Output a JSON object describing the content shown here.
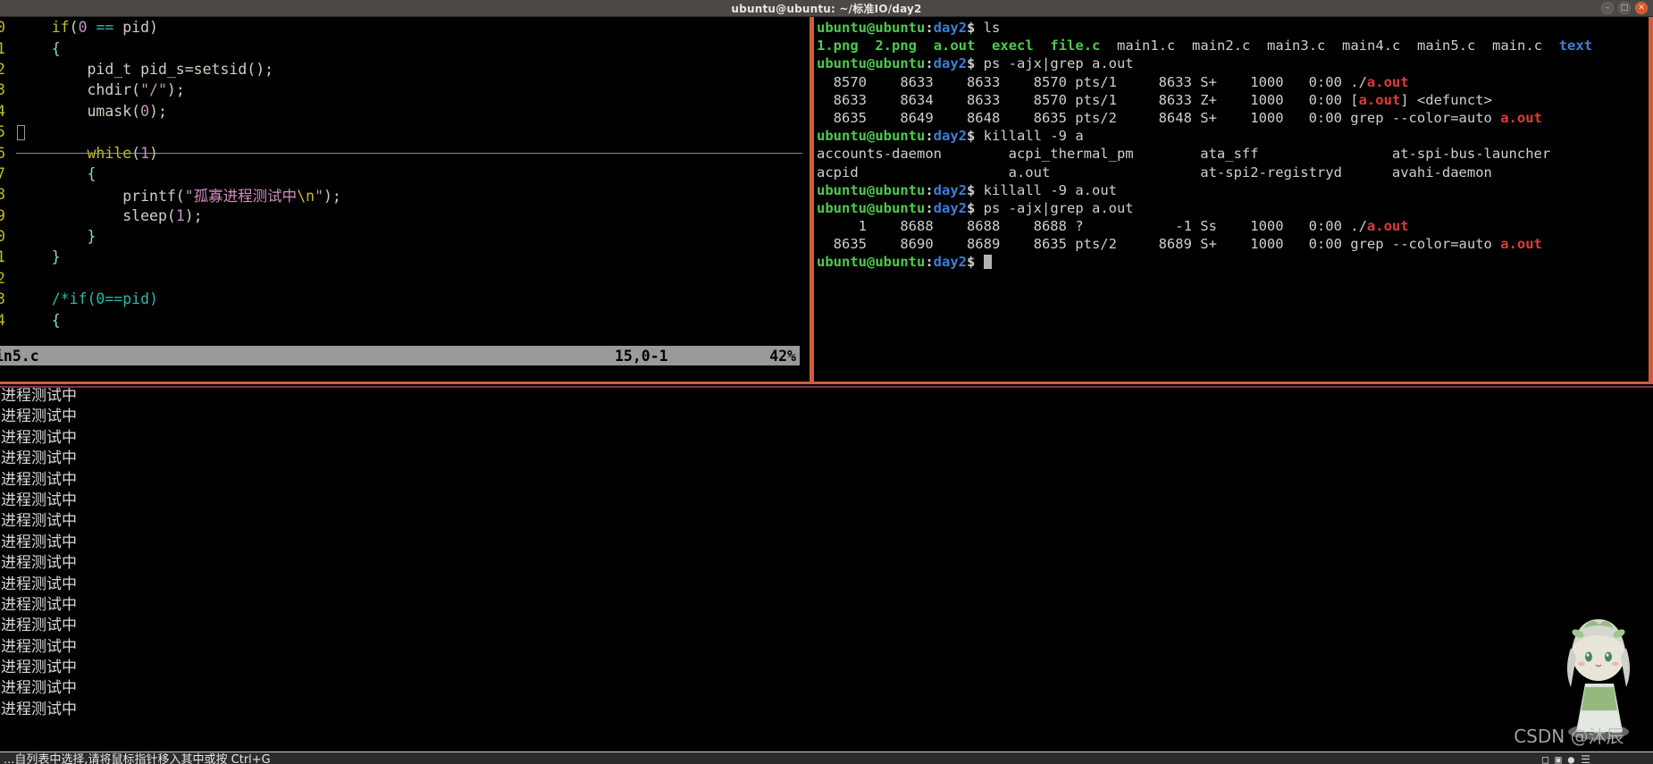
{
  "window": {
    "title": "ubuntu@ubuntu: ~/标准IO/day2",
    "controls": [
      {
        "name": "minimize",
        "glyph": "–"
      },
      {
        "name": "maximize",
        "glyph": "□"
      },
      {
        "name": "close",
        "glyph": "✕"
      }
    ]
  },
  "editor": {
    "filename": "in5.c",
    "position": "15,0-1",
    "percent": "42%",
    "lines": [
      {
        "num": "0",
        "indent": 4,
        "text": "if(0 == pid)"
      },
      {
        "num": "1",
        "indent": 4,
        "text": "{"
      },
      {
        "num": "2",
        "indent": 8,
        "text": "pid_t pid_s=setsid();"
      },
      {
        "num": "3",
        "indent": 8,
        "text": "chdir(\"/\");"
      },
      {
        "num": "4",
        "indent": 8,
        "text": "umask(0);"
      },
      {
        "num": "5",
        "indent": 0,
        "text": ""
      },
      {
        "num": "6",
        "indent": 8,
        "text": "while(1)"
      },
      {
        "num": "7",
        "indent": 8,
        "text": "{"
      },
      {
        "num": "8",
        "indent": 12,
        "text": "printf(\"孤寡进程测试中\\n\");"
      },
      {
        "num": "9",
        "indent": 12,
        "text": "sleep(1);"
      },
      {
        "num": "0",
        "indent": 8,
        "text": "}"
      },
      {
        "num": "1",
        "indent": 4,
        "text": "}"
      },
      {
        "num": "2",
        "indent": 0,
        "text": ""
      },
      {
        "num": "3",
        "indent": 4,
        "text": "/*if(0==pid)"
      },
      {
        "num": "4",
        "indent": 4,
        "text": "{"
      }
    ]
  },
  "shell": {
    "prompt": {
      "user": "ubuntu@ubuntu",
      "colon": ":",
      "path": "day2",
      "dollar": "$ "
    },
    "lines": [
      {
        "type": "prompt",
        "cmd": "ls"
      },
      {
        "type": "ls",
        "items": [
          {
            "name": "1.png",
            "kind": "exec"
          },
          {
            "name": "2.png",
            "kind": "exec"
          },
          {
            "name": "a.out",
            "kind": "exec"
          },
          {
            "name": "execl",
            "kind": "exec"
          },
          {
            "name": "file.c",
            "kind": "exec"
          },
          {
            "name": "main1.c",
            "kind": "plain"
          },
          {
            "name": "main2.c",
            "kind": "plain"
          },
          {
            "name": "main3.c",
            "kind": "plain"
          },
          {
            "name": "main4.c",
            "kind": "plain"
          },
          {
            "name": "main5.c",
            "kind": "plain"
          },
          {
            "name": "main.c",
            "kind": "plain"
          },
          {
            "name": "text",
            "kind": "dir"
          }
        ]
      },
      {
        "type": "prompt",
        "cmd": "ps -ajx|grep a.out"
      },
      {
        "type": "ps",
        "pre": "  8570    8633    8633    8570 pts/1     8633 S+    1000   0:00 ./",
        "hit": "a.out",
        "post": ""
      },
      {
        "type": "ps",
        "pre": "  8633    8634    8633    8570 pts/1     8633 Z+    1000   0:00 [",
        "hit": "a.out",
        "post": "] <defunct>"
      },
      {
        "type": "ps",
        "pre": "  8635    8649    8648    8635 pts/2     8648 S+    1000   0:00 grep --color=auto ",
        "hit": "a.out",
        "post": ""
      },
      {
        "type": "prompt",
        "cmd": "killall -9 a"
      },
      {
        "type": "plain",
        "text": "accounts-daemon        acpi_thermal_pm        ata_sff                at-spi-bus-launcher"
      },
      {
        "type": "plain",
        "text": "acpid                  a.out                  at-spi2-registryd      avahi-daemon"
      },
      {
        "type": "prompt",
        "cmd": "killall -9 a.out"
      },
      {
        "type": "prompt",
        "cmd": "ps -ajx|grep a.out"
      },
      {
        "type": "ps",
        "pre": "     1    8688    8688    8688 ?           -1 Ss    1000   0:00 ./",
        "hit": "a.out",
        "post": ""
      },
      {
        "type": "ps",
        "pre": "  8635    8690    8689    8635 pts/2     8689 S+    1000   0:00 grep --color=auto ",
        "hit": "a.out",
        "post": ""
      },
      {
        "type": "prompt_cursor",
        "cmd": ""
      }
    ]
  },
  "output": {
    "line_text": "寡进程测试中",
    "repeat_count": 16
  },
  "watermark": {
    "text": "CSDN @沐辰ㅤ"
  },
  "bottom_strip": {
    "text": "...自列表中选择,请将鼠标指针移入其中或按 Ctrl+G"
  },
  "colors": {
    "split_border": "#cd5c3c",
    "prompt_green": "#4ec94e",
    "prompt_blue": "#3b7fd4",
    "match_red": "#e03a3a",
    "titlebar": "#4b4845",
    "status_gray": "#9a9a9a",
    "output_sep": "#8a2a4a"
  }
}
